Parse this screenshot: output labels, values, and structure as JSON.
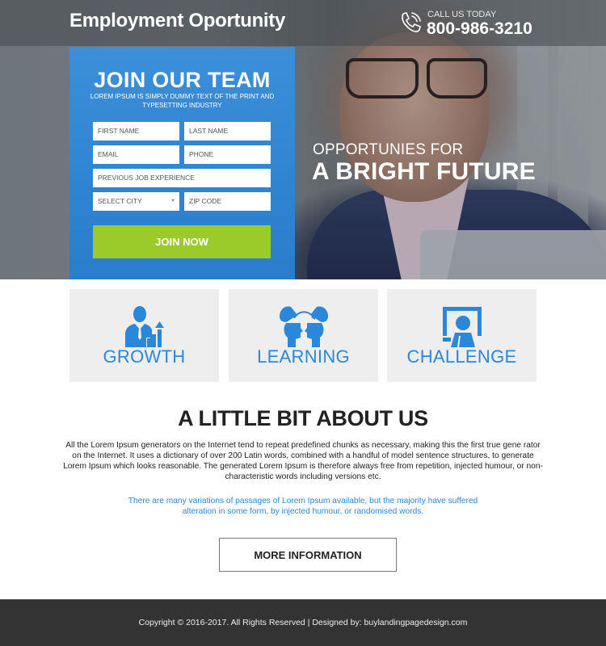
{
  "header": {
    "site_title": "Employment Oportunity",
    "call_label": "CALL US TODAY",
    "phone_number": "800-986-3210",
    "phone_icon": "phone-icon"
  },
  "hero": {
    "tagline_line1": "OPPORTUNIES FOR",
    "tagline_line2": "A BRIGHT FUTURE"
  },
  "form": {
    "title": "JOIN OUR TEAM",
    "subtitle": "LOREM IPSUM IS SIMPLY DUMMY TEXT OF THE PRINT AND TYPESETTING INDUSTRY",
    "fields": {
      "first_name": {
        "placeholder": "FIRST NAME",
        "value": ""
      },
      "last_name": {
        "placeholder": "LAST NAME",
        "value": ""
      },
      "email": {
        "placeholder": "EMAIL",
        "value": ""
      },
      "phone": {
        "placeholder": "PHONE",
        "value": ""
      },
      "experience": {
        "placeholder": "PREVIOUS JOB EXPERIENCE",
        "value": ""
      },
      "city": {
        "selected": "SELECT CITY"
      },
      "zip": {
        "placeholder": "ZIP CODE",
        "value": ""
      }
    },
    "submit_label": "JOIN NOW"
  },
  "features": [
    {
      "label": "GROWTH",
      "icon": "businessman-growth-icon"
    },
    {
      "label": "LEARNING",
      "icon": "heads-exchange-icon"
    },
    {
      "label": "CHALLENGE",
      "icon": "presenter-screen-icon"
    }
  ],
  "about": {
    "title": "A LITTLE BIT ABOUT US",
    "body": "All the Lorem Ipsum generators on the Internet tend to repeat predefined chunks as necessary, making this the first true gene rator on the Internet. It uses a dictionary of over 200 Latin words, combined with a handful of model sentence structures, to generate Lorem Ipsum which looks reasonable. The generated Lorem Ipsum is therefore always free from repetition, injected humour, or non-characteristic words including versions etc.",
    "note": "There are many variations of passages of Lorem Ipsum available, but the majority have suffered alteration in some form, by injected humour, or randomised words.",
    "more_label": "MORE INFORMATION"
  },
  "footer": {
    "text": "Copyright © 2016-2017. All Rights Reserved  |  Designed by: buylandingpagedesign.com"
  },
  "colors": {
    "accent_blue": "#2b87d9",
    "form_blue": "#3088d3",
    "button_green": "#9bca2b",
    "footer_bg": "#333333",
    "feature_bg": "#eeeeee"
  }
}
